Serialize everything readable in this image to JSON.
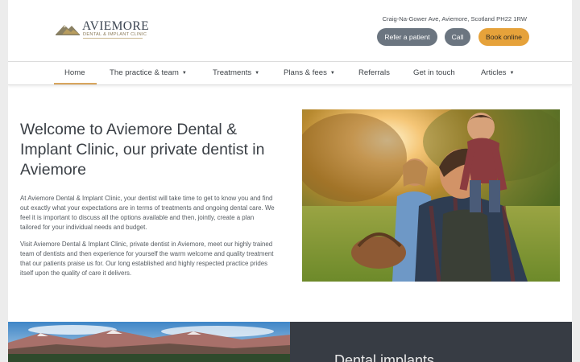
{
  "brand": {
    "name": "AVIEMORE",
    "subtitle": "DENTAL & IMPLANT CLINIC",
    "logo_mark": "mountain-logo-icon",
    "accent_gold": "#d8a55d"
  },
  "header": {
    "address": "Craig-Na-Gower Ave, Aviemore, Scotland PH22 1RW",
    "buttons": {
      "refer": "Refer a patient",
      "call": "Call",
      "book": "Book online"
    },
    "colors": {
      "grey_button": "#6b7580",
      "book_button": "#e6a23a"
    }
  },
  "nav": {
    "items": [
      {
        "label": "Home",
        "has_dropdown": false,
        "active": true
      },
      {
        "label": "The practice & team",
        "has_dropdown": true
      },
      {
        "label": "Treatments",
        "has_dropdown": true
      },
      {
        "label": "Plans & fees",
        "has_dropdown": true
      },
      {
        "label": "Referrals",
        "has_dropdown": false
      },
      {
        "label": "Get in touch",
        "has_dropdown": false
      },
      {
        "label": "Articles",
        "has_dropdown": true
      }
    ],
    "caret": "▼"
  },
  "main": {
    "headline": "Welcome to Aviemore Dental & Implant Clinic, our private dentist in Aviemore",
    "paragraph_1": "At Aviemore Dental & Implant Clinic, your dentist will take time to get to know you and find out exactly what your expectations are in terms of treatments and ongoing dental care. We feel it is important to discuss all the options available and then, jointly, create a plan tailored for your individual needs and budget.",
    "paragraph_2": "Visit Aviemore Dental & Implant Clinic, private dentist in Aviemore, meet our highly trained team of dentists and then experience for yourself the warm welcome and quality treatment that our patients praise us for. Our long established and highly respected practice prides itself upon the quality of care it delivers.",
    "hero_image": "family-outdoors-photo"
  },
  "lower": {
    "left_image": "mountain-landscape-photo",
    "right_title": "Dental implants",
    "right_bg": "#373c44"
  }
}
